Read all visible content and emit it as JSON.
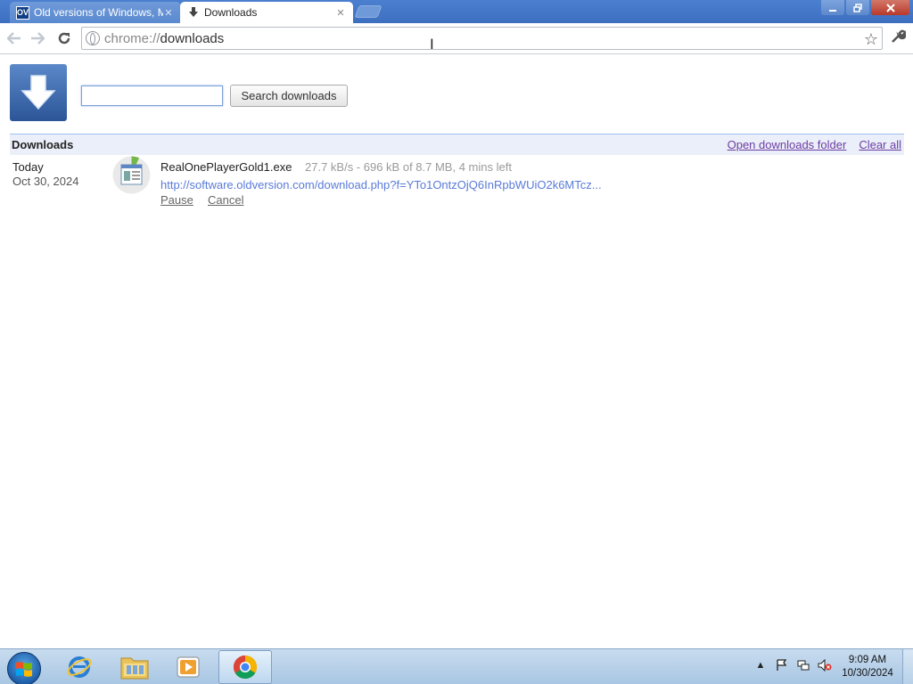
{
  "tabs": [
    {
      "label": "Old versions of Windows, M",
      "favicon": "OV",
      "active": false
    },
    {
      "label": "Downloads",
      "favicon": "download-icon",
      "active": true
    }
  ],
  "omnibox": {
    "scheme": "chrome://",
    "path": "downloads"
  },
  "search": {
    "value": "",
    "button_label": "Search downloads"
  },
  "downloads_header": {
    "title": "Downloads",
    "open_folder_label": "Open downloads folder",
    "clear_all_label": "Clear all"
  },
  "download_item": {
    "date_label": "Today",
    "date_full": "Oct 30, 2024",
    "file_name": "RealOnePlayerGold1.exe",
    "status": "27.7 kB/s - 696 kB of 8.7 MB, 4 mins left",
    "url": "http://software.oldversion.com/download.php?f=YTo1OntzOjQ6InRpbWUiO2k6MTcz...",
    "pause_label": "Pause",
    "cancel_label": "Cancel"
  },
  "taskbar": {
    "apps": [
      "start-icon",
      "internet-explorer-icon",
      "file-explorer-icon",
      "media-player-icon",
      "chrome-icon"
    ],
    "clock_time": "9:09 AM",
    "clock_date": "10/30/2024"
  },
  "colors": {
    "titlebar": "#4275c6",
    "link_purple": "#6d3da3",
    "url_blue": "#5a7bd8",
    "header_bg": "#ebeff9"
  }
}
